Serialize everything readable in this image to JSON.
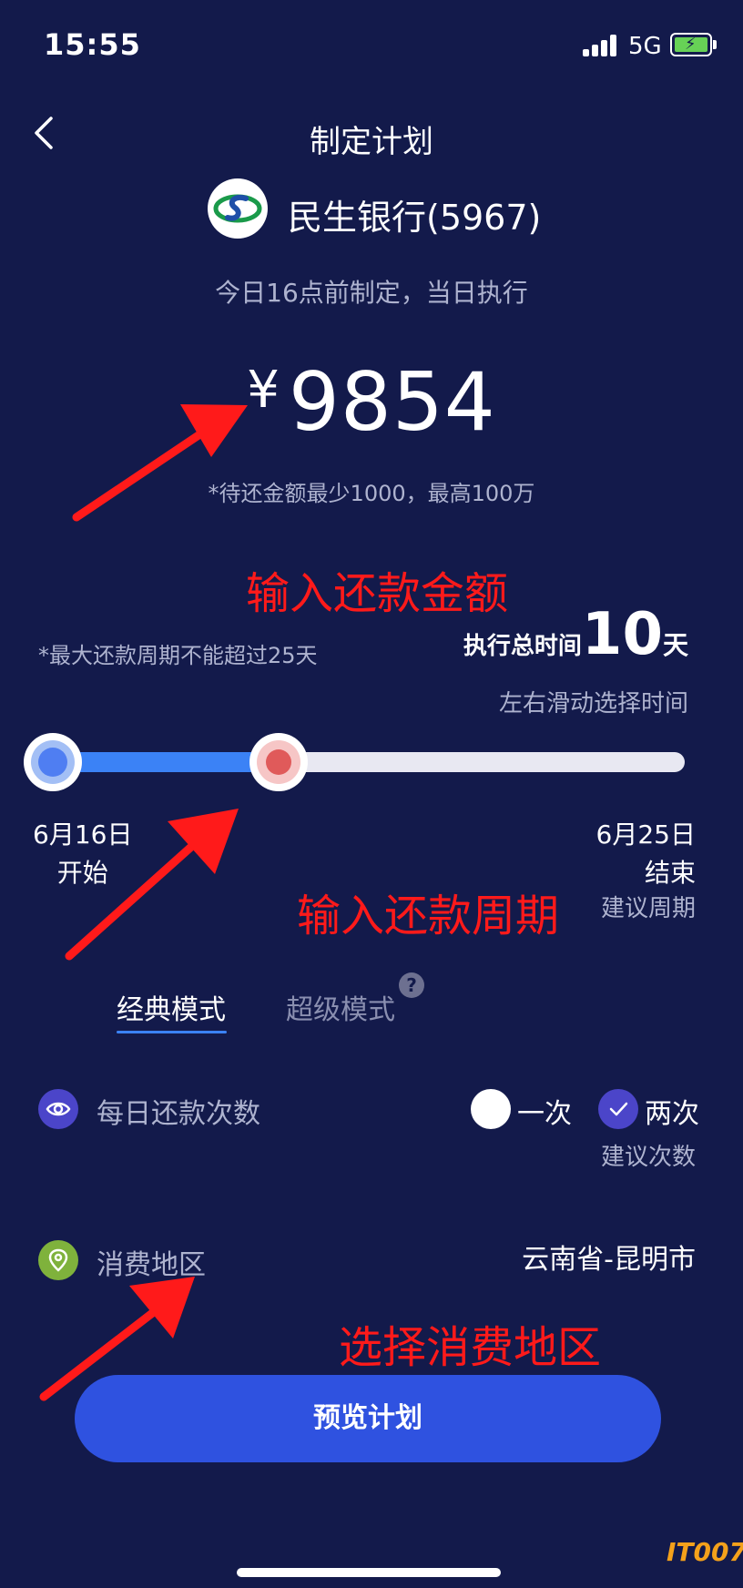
{
  "status_bar": {
    "time": "15:55",
    "network": "5G"
  },
  "header": {
    "title": "制定计划",
    "bank_name": "民生银行(5967)",
    "subtitle": "今日16点前制定，当日执行"
  },
  "amount": {
    "currency": "¥",
    "value": "9854",
    "hint": "*待还金额最少1000，最高100万"
  },
  "annotations": {
    "amount_note": "输入还款金额",
    "period_note": "输入还款周期",
    "area_note": "选择消费地区",
    "arrow_color": "#ff1a1a"
  },
  "period": {
    "max_hint": "*最大还款周期不能超过25天",
    "total_label": "执行总时间",
    "total_days": "10",
    "total_unit": "天",
    "slide_hint": "左右滑动选择时间",
    "selected_fraction": 0.36,
    "start_date": "6月16日",
    "start_label": "开始",
    "end_date": "6月25日",
    "end_label": "结束",
    "end_suggest": "建议周期"
  },
  "tabs": {
    "classic": "经典模式",
    "super": "超级模式",
    "active": "classic"
  },
  "repay_times": {
    "label": "每日还款次数",
    "option_once": "一次",
    "option_twice": "两次",
    "selected": "两次",
    "suggest": "建议次数"
  },
  "consume_area": {
    "label": "消费地区",
    "value": "云南省-昆明市"
  },
  "preview_button": "预览计划",
  "watermark": "IT007",
  "colors": {
    "background": "#131a4b",
    "accent": "#2f52e0",
    "track_fill": "#3b82f6"
  }
}
